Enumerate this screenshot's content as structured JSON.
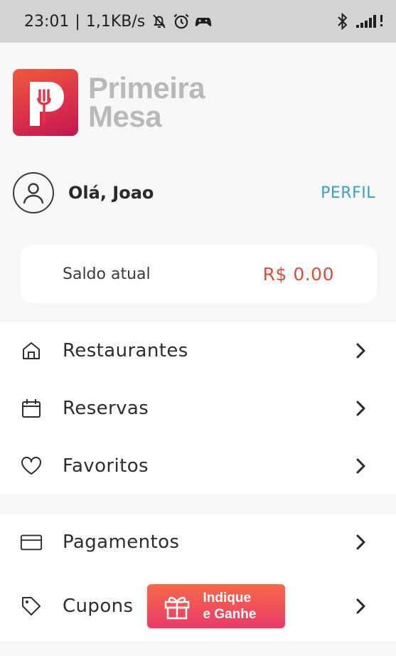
{
  "status_bar": {
    "time": "23:01",
    "separator": "|",
    "network_speed": "1,1KB/s",
    "icons": [
      "mute-bell-icon",
      "alarm-icon",
      "game-icon",
      "bluetooth-icon",
      "signal-icon"
    ]
  },
  "brand": {
    "name_line1": "Primeira",
    "name_line2": "Mesa",
    "logo_letter_icon": "p-fork-logo"
  },
  "user": {
    "greeting": "Olá, Joao",
    "profile_link": "PERFIL"
  },
  "balance": {
    "label": "Saldo atual",
    "value": "R$ 0.00"
  },
  "menu_main": [
    {
      "label": "Restaurantes",
      "icon": "home-icon"
    },
    {
      "label": "Reservas",
      "icon": "calendar-icon"
    },
    {
      "label": "Favoritos",
      "icon": "heart-icon"
    }
  ],
  "menu_secondary": [
    {
      "label": "Pagamentos",
      "icon": "card-icon"
    },
    {
      "label": "Cupons",
      "icon": "tag-icon"
    }
  ],
  "promo": {
    "line1": "Indique",
    "line2": "e Ganhe",
    "icon": "gift-icon"
  },
  "colors": {
    "accent": "#3aa1c3",
    "balance": "#d84e3f",
    "brand_gradient_start": "#ef5a3c",
    "brand_gradient_end": "#c4164f"
  }
}
